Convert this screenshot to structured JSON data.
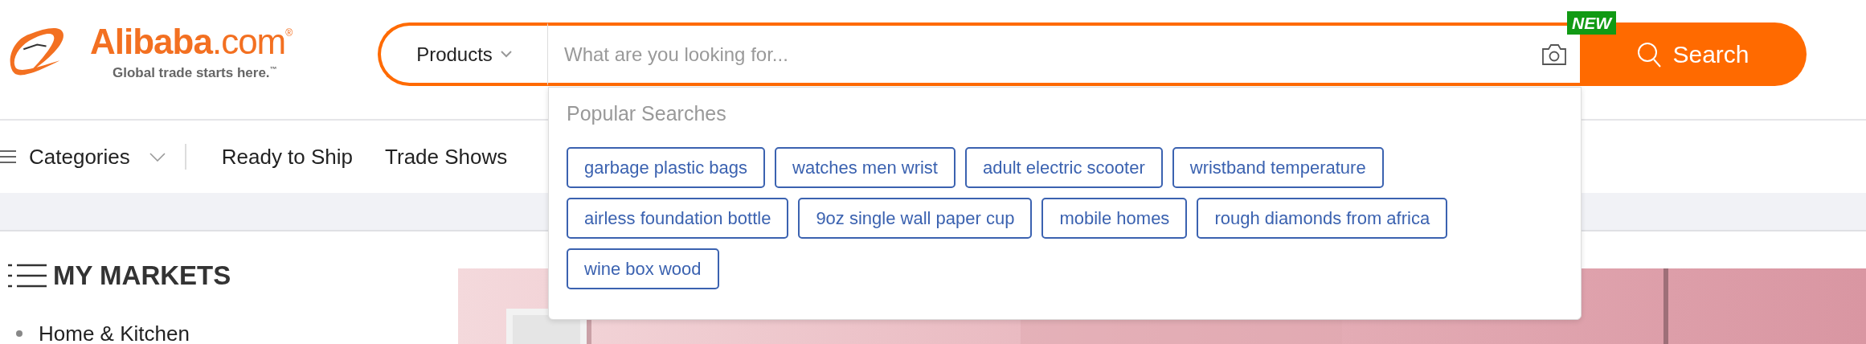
{
  "logo": {
    "name": "**Alibaba**.com$^{®}$",
    "tagline": "Global trade starts here.$^{™}$"
  },
  "search": {
    "scope": "Products",
    "placeholder": "What are you looking for...",
    "badge": "NEW",
    "button": "Search"
  },
  "popular_searches": {
    "title": "Popular Searches",
    "tags": [
      "garbage plastic bags",
      "watches men wrist",
      "adult electric scooter",
      "wristband temperature",
      "airless foundation bottle",
      "9oz single wall paper cup",
      "mobile homes",
      "rough diamonds from africa",
      "wine box wood"
    ]
  },
  "nav": {
    "categories": "Categories",
    "links": [
      "Ready to Ship",
      "Trade Shows"
    ]
  },
  "sidebar": {
    "title": "MY MARKETS",
    "items": [
      "Home & Kitchen"
    ]
  }
}
